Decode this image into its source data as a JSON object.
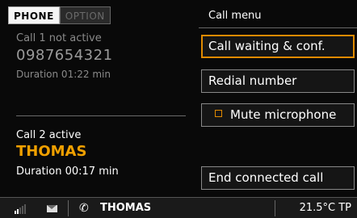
{
  "tabs": [
    {
      "label": "PHONE",
      "active": true
    },
    {
      "label": "OPTION",
      "active": false
    }
  ],
  "call1": {
    "status": "Call 1 not active",
    "number": "0987654321",
    "duration": "Duration 01:22 min"
  },
  "call2": {
    "status": "Call 2 active",
    "name": "THOMAS",
    "duration": "Duration 00:17 min"
  },
  "menu": {
    "title": "Call menu",
    "items": [
      {
        "label": "Call waiting & conf.",
        "selected": true
      },
      {
        "label": "Redial number",
        "selected": false
      },
      {
        "label": "Mute microphone",
        "selected": false,
        "checkbox": true
      },
      {
        "label": "End connected call",
        "selected": false
      }
    ]
  },
  "status_bar": {
    "signal_icon": "signal-strength-icon",
    "signal_bars_filled": 2,
    "signal_bars_total": 5,
    "message_icon": "envelope-icon",
    "phone_icon": "phone-handset-icon",
    "caller_name": "THOMAS",
    "temperature": "21.5°C TP"
  },
  "colors": {
    "accent": "#e08a00",
    "active_name": "#f0a000",
    "background": "#090909"
  }
}
